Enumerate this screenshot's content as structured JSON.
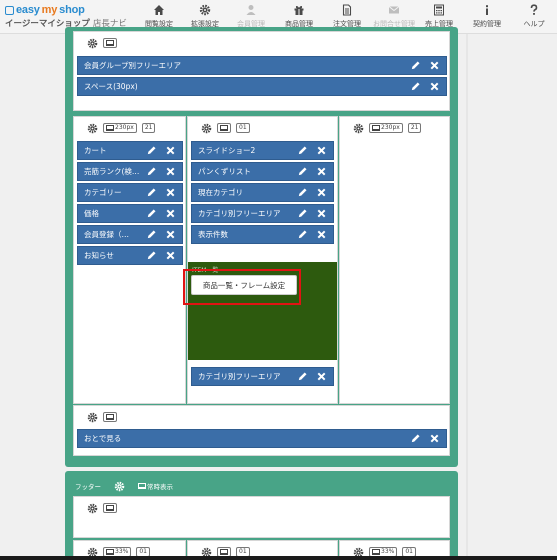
{
  "app": {
    "logo_text_easy": "easy",
    "logo_text_my": "my",
    "logo_text_shop": "shop",
    "logo_subtitle": "イージーマイショップ",
    "logo_subtitle_suffix": "店長ナビ"
  },
  "nav": [
    {
      "label": "閲覧設定",
      "icon": "home-icon",
      "disabled": false
    },
    {
      "label": "拡張設定",
      "icon": "gear-icon",
      "disabled": false
    },
    {
      "label": "会員管理",
      "icon": "user-icon",
      "disabled": true
    },
    {
      "label": "商品管理",
      "icon": "gift-icon",
      "disabled": false
    },
    {
      "label": "注文管理",
      "icon": "document-icon",
      "disabled": false
    },
    {
      "label": "お問合せ管理",
      "icon": "mail-icon",
      "disabled": true
    },
    {
      "label": "売上管理",
      "icon": "calculator-icon",
      "disabled": false
    },
    {
      "label": "契約管理",
      "icon": "info-icon",
      "disabled": false
    },
    {
      "label": "ヘルプ",
      "icon": "help-icon",
      "disabled": false
    }
  ],
  "top_section": {
    "items": [
      {
        "label": "会員グループ別フリーエリア"
      },
      {
        "label": "スペース(30px)"
      }
    ]
  },
  "left_column": {
    "width_label": "230px",
    "count_label": "21",
    "items": [
      {
        "label": "カート"
      },
      {
        "label": "売筋ランク(検…"
      },
      {
        "label": "カテゴリー"
      },
      {
        "label": "価格"
      },
      {
        "label": "会員登録（…"
      },
      {
        "label": "お知らせ"
      }
    ]
  },
  "center_column": {
    "count_label": "01",
    "items": [
      {
        "label": "スライドショー2"
      },
      {
        "label": "パンくずリスト"
      },
      {
        "label": "現在カテゴリ"
      },
      {
        "label": "カテゴリ別フリーエリア"
      },
      {
        "label": "表示件数"
      }
    ],
    "product_block_label": "ITEM一覧",
    "frame_button_label": "商品一覧・フレーム設定",
    "bottom_item": {
      "label": "カテゴリ別フリーエリア"
    }
  },
  "right_column": {
    "width_label": "230px",
    "count_label": "21"
  },
  "bottom_section": {
    "items": [
      {
        "label": "おとで見る"
      }
    ]
  },
  "footer": {
    "label": "フッター",
    "display_label": "常時表示",
    "width_label": "33%",
    "count_label": "01",
    "width_label_right": "33%"
  },
  "colors": {
    "panel_green": "#48a487",
    "bar_blue": "#3b6ea8",
    "product_green": "#2d5a0e",
    "highlight_red": "#e11313"
  }
}
